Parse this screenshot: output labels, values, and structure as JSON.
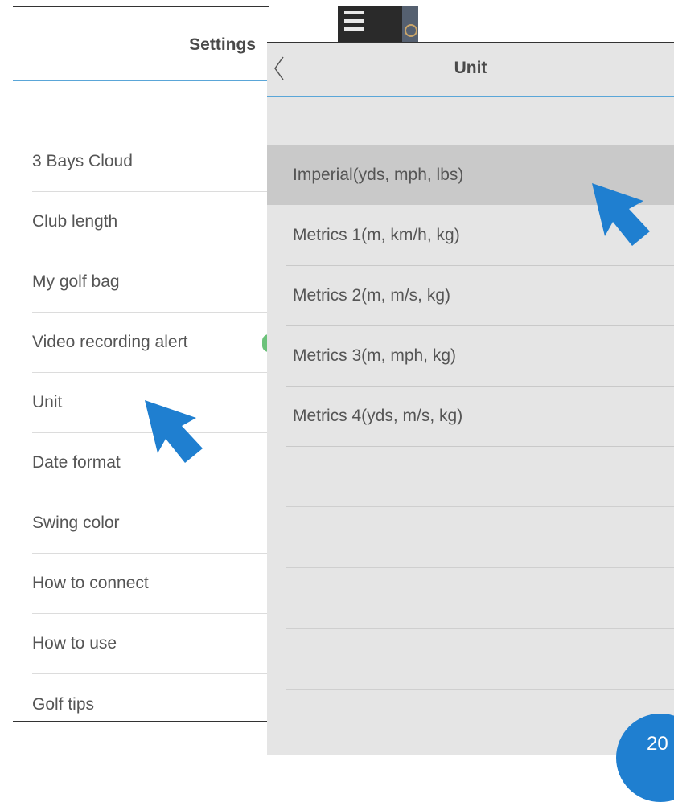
{
  "settings": {
    "title": "Settings",
    "items": [
      {
        "label": "3 Bays Cloud"
      },
      {
        "label": "Club length"
      },
      {
        "label": "My golf bag"
      },
      {
        "label": "Video recording alert"
      },
      {
        "label": "Unit"
      },
      {
        "label": "Date format"
      },
      {
        "label": "Swing color"
      },
      {
        "label": "How to connect"
      },
      {
        "label": "How to use"
      },
      {
        "label": "Golf tips"
      }
    ]
  },
  "unit_panel": {
    "title": "Unit",
    "back_icon": "chevron-left-icon",
    "options": [
      {
        "label": "Imperial(yds, mph, lbs)",
        "selected": true
      },
      {
        "label": "Metrics 1(m, km/h, kg)",
        "selected": false
      },
      {
        "label": "Metrics 2(m, m/s, kg)",
        "selected": false
      },
      {
        "label": "Metrics 3(m, mph, kg)",
        "selected": false
      },
      {
        "label": "Metrics 4(yds, m/s, kg)",
        "selected": false
      }
    ]
  },
  "page_badge": {
    "text": "20"
  },
  "colors": {
    "accent": "#5aa6d8",
    "arrow": "#1f7fd0",
    "selected_row": "#c9c9c9",
    "panel_bg": "#e5e5e5"
  }
}
